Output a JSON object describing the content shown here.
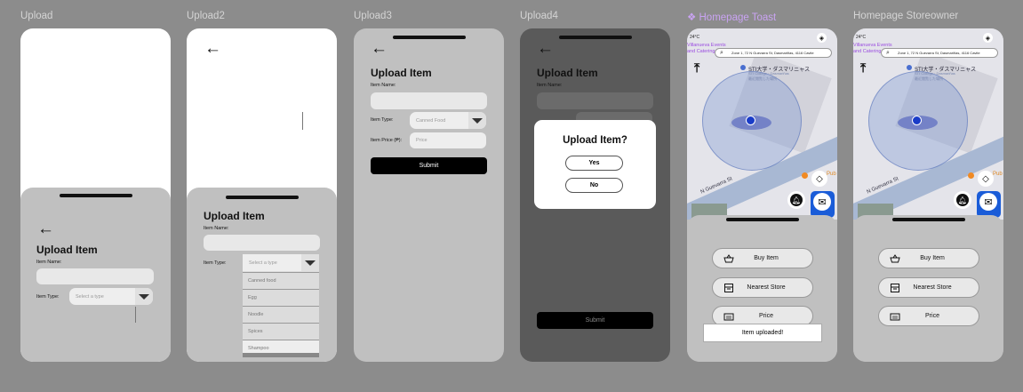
{
  "frames": [
    {
      "label": "Upload",
      "component": false
    },
    {
      "label": "Upload2",
      "component": false
    },
    {
      "label": "Upload3",
      "component": false
    },
    {
      "label": "Upload4",
      "component": false
    },
    {
      "label": "❖ Homepage Toast",
      "component": true
    },
    {
      "label": "Homepage Storeowner",
      "component": false
    }
  ],
  "form": {
    "title": "Upload Item",
    "item_name_label": "Item Name:",
    "item_type_label": "Item Type:",
    "item_price_label": "Item Price (₱):",
    "type_placeholder": "Select a type",
    "type_selected": "Canned Food",
    "price_placeholder": "Price",
    "submit_label": "Submit",
    "type_options": [
      "Canned food",
      "Egg",
      "Noodle",
      "Spices",
      "Shampoo"
    ]
  },
  "modal": {
    "title": "Upload Item?",
    "yes_label": "Yes",
    "no_label": "No"
  },
  "home": {
    "weather": "24°C",
    "event_text": "Villanueva Events",
    "event_text2": "and Catering R...",
    "search_text": "Zone 1, 72 N Guevarra St, Dasmariñas, 4116 Cavite",
    "place_name": "STI大学・ダスマリニャス",
    "place_sub1": "STI College · Dasmariñas",
    "place_sub2": "最近閲覧した場所",
    "street_name": "N Guevarra St",
    "side_text": "Pub",
    "menu": [
      {
        "label": "Buy Item",
        "icon": "basket-icon"
      },
      {
        "label": "Nearest Store",
        "icon": "store-icon"
      },
      {
        "label": "Price",
        "icon": "sale-icon"
      }
    ],
    "toast": "Item uploaded!"
  },
  "colors": {
    "canvas": "#8c8c8c",
    "panel": "#c0c0c0",
    "accent_black": "#000000",
    "location_dot": "#1a3cc8",
    "component_label": "#c9a3f2"
  }
}
